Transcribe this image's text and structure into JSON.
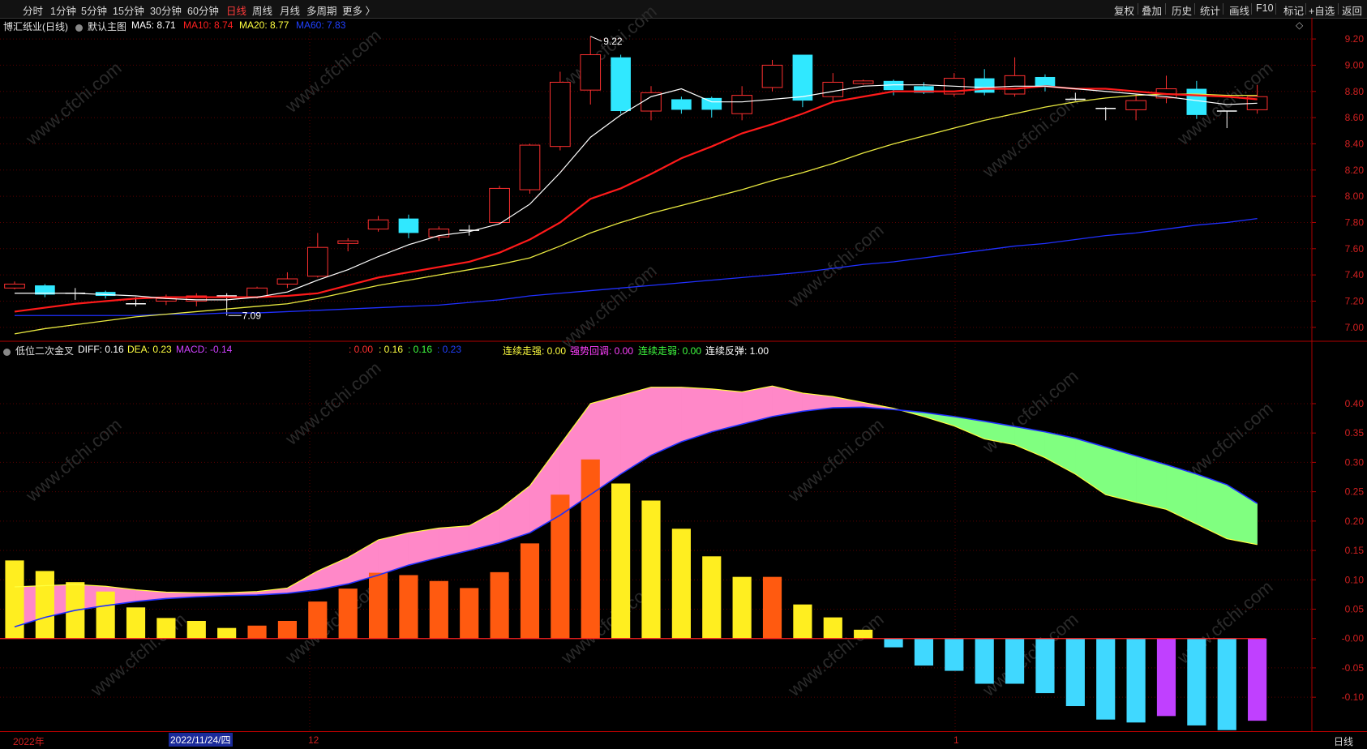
{
  "toolbar": {
    "periods": [
      "分时",
      "1分钟",
      "5分钟",
      "15分钟",
      "30分钟",
      "60分钟",
      "日线",
      "周线",
      "月线",
      "多周期",
      "更多 〉"
    ],
    "active_period": "日线",
    "right_buttons": [
      "复权",
      "叠加",
      "历史",
      "统计",
      "画线",
      "F10",
      "标记",
      "+自选",
      "返回"
    ]
  },
  "main_panel": {
    "title": "博汇纸业(日线)",
    "template": "默认主图",
    "ma_labels": [
      {
        "text": "MA5: 8.71",
        "color": "#ffffff"
      },
      {
        "text": "MA10: 8.74",
        "color": "#ff2020"
      },
      {
        "text": "MA20: 8.77",
        "color": "#ffff40"
      },
      {
        "text": "MA60: 7.83",
        "color": "#2040ff"
      }
    ],
    "high_label": "9.22",
    "low_label": "7.09"
  },
  "sub_panel": {
    "title": "低位二次金叉",
    "labels": [
      {
        "text": "DIFF: 0.16",
        "color": "#ffffff"
      },
      {
        "text": "DEA: 0.23",
        "color": "#ffff40"
      },
      {
        "text": "MACD: -0.14",
        "color": "#d040ff"
      }
    ],
    "labels2": [
      {
        "text": ": 0.00",
        "color": "#ff3030"
      },
      {
        "text": ": 0.16",
        "color": "#ffff40"
      },
      {
        "text": ": 0.16",
        "color": "#40ff40"
      },
      {
        "text": ": 0.23",
        "color": "#2040ff"
      }
    ],
    "labels3": [
      {
        "text": "连续走强: 0.00",
        "color": "#ffff40"
      },
      {
        "text": "强势回调: 0.00",
        "color": "#ff40ff"
      },
      {
        "text": "连续走弱: 0.00",
        "color": "#40ff40"
      },
      {
        "text": "连续反弹: 1.00",
        "color": "#ffffff"
      }
    ]
  },
  "bottom_bar": {
    "year_label": "2022年",
    "cursor_date": "2022/11/24/四",
    "month_dec": "12",
    "month_jan": "1",
    "period_label": "日线"
  },
  "watermark": "www.cfchi.com",
  "chart_data": [
    {
      "type": "candlestick",
      "ylim": [
        6.9,
        9.25
      ],
      "y_ticks": [
        "9.20",
        "9.00",
        "8.80",
        "8.60",
        "8.40",
        "8.20",
        "8.00",
        "7.80",
        "7.60",
        "7.40",
        "7.20",
        "7.00"
      ],
      "candles": [
        [
          7.3,
          7.33,
          7.35,
          7.29
        ],
        [
          7.32,
          7.25,
          7.33,
          7.23
        ],
        [
          7.26,
          7.26,
          7.3,
          7.21
        ],
        [
          7.27,
          7.24,
          7.28,
          7.22
        ],
        [
          7.18,
          7.18,
          7.23,
          7.16
        ],
        [
          7.2,
          7.22,
          7.25,
          7.17
        ],
        [
          7.2,
          7.24,
          7.26,
          7.16
        ],
        [
          7.23,
          7.24,
          7.26,
          7.09
        ],
        [
          7.23,
          7.3,
          7.31,
          7.22
        ],
        [
          7.33,
          7.37,
          7.42,
          7.3
        ],
        [
          7.39,
          7.61,
          7.72,
          7.38
        ],
        [
          7.64,
          7.66,
          7.68,
          7.58
        ],
        [
          7.75,
          7.82,
          7.85,
          7.73
        ],
        [
          7.83,
          7.72,
          7.86,
          7.68
        ],
        [
          7.69,
          7.75,
          7.77,
          7.66
        ],
        [
          7.73,
          7.74,
          7.78,
          7.7
        ],
        [
          7.8,
          8.06,
          8.08,
          7.79
        ],
        [
          8.05,
          8.39,
          8.4,
          8.02
        ],
        [
          8.38,
          8.87,
          8.95,
          8.35
        ],
        [
          8.81,
          9.08,
          9.22,
          8.7
        ],
        [
          9.06,
          8.65,
          9.08,
          8.63
        ],
        [
          8.65,
          8.79,
          8.84,
          8.58
        ],
        [
          8.74,
          8.66,
          8.76,
          8.63
        ],
        [
          8.75,
          8.66,
          8.76,
          8.6
        ],
        [
          8.63,
          8.77,
          8.84,
          8.58
        ],
        [
          8.83,
          9.0,
          9.04,
          8.8
        ],
        [
          9.08,
          8.73,
          9.08,
          8.68
        ],
        [
          8.76,
          8.87,
          8.94,
          8.72
        ],
        [
          8.86,
          8.88,
          8.89,
          8.85
        ],
        [
          8.88,
          8.81,
          8.89,
          8.77
        ],
        [
          8.84,
          8.79,
          8.87,
          8.78
        ],
        [
          8.78,
          8.9,
          8.94,
          8.76
        ],
        [
          8.9,
          8.79,
          8.97,
          8.77
        ],
        [
          8.78,
          8.92,
          9.06,
          8.76
        ],
        [
          8.91,
          8.84,
          8.93,
          8.8
        ],
        [
          8.74,
          8.74,
          8.79,
          8.73
        ],
        [
          8.67,
          8.67,
          8.68,
          8.58
        ],
        [
          8.66,
          8.73,
          8.78,
          8.58
        ],
        [
          8.75,
          8.82,
          8.92,
          8.71
        ],
        [
          8.82,
          8.62,
          8.88,
          8.59
        ],
        [
          8.65,
          8.65,
          8.65,
          8.52
        ],
        [
          8.66,
          8.76,
          8.85,
          8.63
        ]
      ],
      "ma5": [
        7.26,
        7.26,
        7.26,
        7.25,
        7.24,
        7.22,
        7.21,
        7.21,
        7.23,
        7.27,
        7.36,
        7.44,
        7.54,
        7.63,
        7.7,
        7.73,
        7.79,
        7.94,
        8.18,
        8.45,
        8.62,
        8.76,
        8.82,
        8.72,
        8.72,
        8.74,
        8.76,
        8.8,
        8.84,
        8.85,
        8.85,
        8.84,
        8.83,
        8.84,
        8.84,
        8.82,
        8.8,
        8.78,
        8.76,
        8.73,
        8.7,
        8.71
      ],
      "ma10": [
        7.12,
        7.15,
        7.18,
        7.2,
        7.22,
        7.23,
        7.23,
        7.23,
        7.23,
        7.24,
        7.26,
        7.32,
        7.38,
        7.42,
        7.46,
        7.5,
        7.57,
        7.67,
        7.8,
        7.98,
        8.06,
        8.17,
        8.29,
        8.38,
        8.48,
        8.55,
        8.63,
        8.72,
        8.76,
        8.8,
        8.8,
        8.8,
        8.82,
        8.82,
        8.84,
        8.82,
        8.82,
        8.8,
        8.78,
        8.77,
        8.76,
        8.74
      ],
      "ma20": [
        6.95,
        6.99,
        7.02,
        7.05,
        7.08,
        7.1,
        7.12,
        7.14,
        7.16,
        7.18,
        7.22,
        7.27,
        7.32,
        7.36,
        7.4,
        7.44,
        7.48,
        7.53,
        7.62,
        7.72,
        7.8,
        7.87,
        7.93,
        7.99,
        8.05,
        8.12,
        8.18,
        8.25,
        8.33,
        8.4,
        8.46,
        8.52,
        8.58,
        8.63,
        8.68,
        8.72,
        8.75,
        8.77,
        8.78,
        8.78,
        8.77,
        8.77
      ],
      "ma60": [
        7.09,
        7.09,
        7.09,
        7.09,
        7.09,
        7.1,
        7.1,
        7.11,
        7.11,
        7.12,
        7.13,
        7.14,
        7.15,
        7.16,
        7.17,
        7.19,
        7.21,
        7.24,
        7.26,
        7.28,
        7.3,
        7.32,
        7.34,
        7.36,
        7.38,
        7.4,
        7.42,
        7.45,
        7.48,
        7.5,
        7.53,
        7.56,
        7.59,
        7.62,
        7.64,
        7.67,
        7.7,
        7.72,
        7.75,
        7.78,
        7.8,
        7.83
      ]
    },
    {
      "type": "bar",
      "title": "低位二次金叉",
      "ylim": [
        -0.155,
        0.48
      ],
      "y_ticks": [
        "0.40",
        "0.35",
        "0.30",
        "0.25",
        "0.20",
        "0.15",
        "0.10",
        "0.05",
        "-0.00",
        "-0.05",
        "-0.10"
      ],
      "macd": [
        0.133,
        0.115,
        0.096,
        0.08,
        0.053,
        0.035,
        0.03,
        0.018,
        0.022,
        0.03,
        0.063,
        0.085,
        0.112,
        0.108,
        0.098,
        0.086,
        0.113,
        0.162,
        0.245,
        0.305,
        0.264,
        0.235,
        0.187,
        0.14,
        0.105,
        0.105,
        0.058,
        0.036,
        0.015,
        -0.015,
        -0.046,
        -0.055,
        -0.077,
        -0.077,
        -0.093,
        -0.115,
        -0.138,
        -0.143,
        -0.132,
        -0.148,
        -0.156,
        -0.14
      ],
      "diff": [
        0.088,
        0.09,
        0.092,
        0.089,
        0.083,
        0.079,
        0.078,
        0.078,
        0.08,
        0.086,
        0.115,
        0.138,
        0.168,
        0.18,
        0.188,
        0.192,
        0.22,
        0.26,
        0.33,
        0.4,
        0.414,
        0.428,
        0.428,
        0.425,
        0.42,
        0.43,
        0.418,
        0.412,
        0.402,
        0.392,
        0.378,
        0.362,
        0.34,
        0.33,
        0.308,
        0.28,
        0.245,
        0.232,
        0.22,
        0.195,
        0.17,
        0.16
      ],
      "dea": [
        0.02,
        0.036,
        0.048,
        0.056,
        0.063,
        0.068,
        0.071,
        0.073,
        0.074,
        0.077,
        0.083,
        0.093,
        0.108,
        0.125,
        0.138,
        0.15,
        0.163,
        0.18,
        0.21,
        0.245,
        0.28,
        0.312,
        0.335,
        0.352,
        0.365,
        0.378,
        0.387,
        0.393,
        0.394,
        0.39,
        0.385,
        0.378,
        0.37,
        0.361,
        0.352,
        0.341,
        0.326,
        0.311,
        0.296,
        0.28,
        0.262,
        0.23
      ]
    }
  ]
}
